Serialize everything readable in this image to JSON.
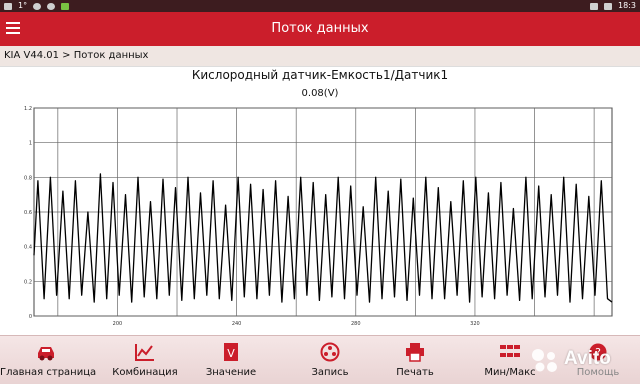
{
  "status_bar": {
    "left_text": "1°",
    "right_text": "18:3"
  },
  "header": {
    "title": "Поток данных",
    "menu_icon": "hamburger-menu-icon"
  },
  "breadcrumb": {
    "text": "KIA V44.01 > Поток данных"
  },
  "chart_data": {
    "type": "line",
    "title": "Кислородный датчик-Емкость1/Датчик1",
    "current_value": "0.08(V)",
    "ylim": [
      0,
      1.2
    ],
    "y_ticks": [
      "0",
      "0.2",
      "0.4",
      "0.6",
      "0.8",
      "1",
      "1.2"
    ],
    "xlim": [
      172,
      366
    ],
    "x_ticks": [
      "200",
      "240",
      "280",
      "320"
    ],
    "grid": true,
    "series": [
      {
        "color": "#000000",
        "x": [
          172,
          173.3,
          175.4,
          177.5,
          179.6,
          181.7,
          183.8,
          185.9,
          188.0,
          190.1,
          192.2,
          194.3,
          196.4,
          198.5,
          200.6,
          202.7,
          204.8,
          206.9,
          209.0,
          211.1,
          213.2,
          215.3,
          217.4,
          219.5,
          221.6,
          223.7,
          225.8,
          227.9,
          230.0,
          232.1,
          234.2,
          236.3,
          238.4,
          240.5,
          242.6,
          244.7,
          246.8,
          248.9,
          251.0,
          253.1,
          255.2,
          257.3,
          259.4,
          261.5,
          263.6,
          265.7,
          267.8,
          269.9,
          272.0,
          274.1,
          276.2,
          278.3,
          280.4,
          282.5,
          284.6,
          286.7,
          288.8,
          290.9,
          293.0,
          295.1,
          297.2,
          299.3,
          301.4,
          303.5,
          305.6,
          307.7,
          309.8,
          311.9,
          314.0,
          316.1,
          318.2,
          320.3,
          322.4,
          324.5,
          326.6,
          328.7,
          330.8,
          332.9,
          335.0,
          337.1,
          339.2,
          341.4,
          343.5,
          345.6,
          347.7,
          349.8,
          351.9,
          354.0,
          356.1,
          358.2,
          360.3,
          362.4,
          364.5,
          366.0
        ],
        "y": [
          0.35,
          0.78,
          0.1,
          0.8,
          0.12,
          0.72,
          0.1,
          0.78,
          0.12,
          0.6,
          0.08,
          0.82,
          0.1,
          0.77,
          0.12,
          0.7,
          0.08,
          0.8,
          0.11,
          0.66,
          0.1,
          0.79,
          0.12,
          0.74,
          0.09,
          0.8,
          0.1,
          0.71,
          0.12,
          0.78,
          0.1,
          0.64,
          0.09,
          0.8,
          0.11,
          0.76,
          0.1,
          0.73,
          0.12,
          0.78,
          0.08,
          0.69,
          0.1,
          0.8,
          0.12,
          0.77,
          0.09,
          0.7,
          0.11,
          0.8,
          0.1,
          0.75,
          0.12,
          0.63,
          0.08,
          0.8,
          0.1,
          0.72,
          0.11,
          0.79,
          0.09,
          0.68,
          0.12,
          0.8,
          0.1,
          0.74,
          0.1,
          0.66,
          0.12,
          0.78,
          0.08,
          0.8,
          0.11,
          0.71,
          0.1,
          0.77,
          0.12,
          0.62,
          0.09,
          0.8,
          0.1,
          0.75,
          0.11,
          0.7,
          0.12,
          0.8,
          0.08,
          0.76,
          0.1,
          0.69,
          0.12,
          0.78,
          0.1,
          0.08
        ]
      }
    ]
  },
  "toolbar": {
    "buttons": [
      {
        "label": "Главная страница",
        "icon": "car-home-icon"
      },
      {
        "label": "Комбинация",
        "icon": "combination-chart-icon"
      },
      {
        "label": "Значение",
        "icon": "value-document-icon"
      },
      {
        "label": "Запись",
        "icon": "record-reel-icon"
      },
      {
        "label": "Печать",
        "icon": "printer-icon"
      },
      {
        "label": "Мин/Макс",
        "icon": "min-max-icon"
      },
      {
        "label": "Помощь",
        "icon": "help-icon"
      }
    ]
  },
  "watermark": {
    "text": "Avito"
  },
  "colors": {
    "accent": "#cb1e2b",
    "toolbar_bg": "#f0dede",
    "icon": "#cb1e2b"
  }
}
